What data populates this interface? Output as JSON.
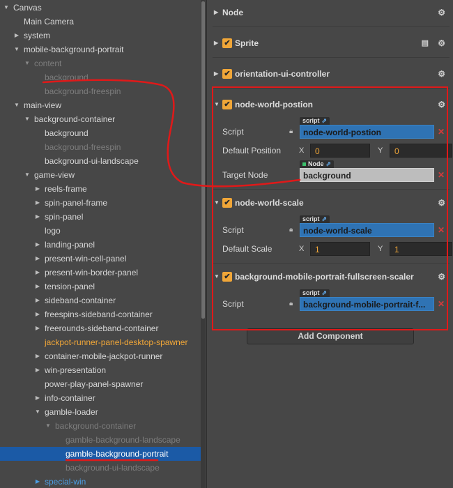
{
  "hierarchy": {
    "items": [
      {
        "label": "Canvas",
        "arrow": "down",
        "depth": 0,
        "style": ""
      },
      {
        "label": "Main Camera",
        "arrow": "",
        "depth": 1,
        "style": ""
      },
      {
        "label": "system",
        "arrow": "right",
        "depth": 1,
        "style": ""
      },
      {
        "label": "mobile-background-portrait",
        "arrow": "down",
        "depth": 1,
        "style": ""
      },
      {
        "label": "content",
        "arrow": "down",
        "depth": 2,
        "style": "dim"
      },
      {
        "label": "background",
        "arrow": "",
        "depth": 3,
        "style": "dim"
      },
      {
        "label": "background-freespin",
        "arrow": "",
        "depth": 3,
        "style": "dim"
      },
      {
        "label": "main-view",
        "arrow": "down",
        "depth": 1,
        "style": ""
      },
      {
        "label": "background-container",
        "arrow": "down",
        "depth": 2,
        "style": ""
      },
      {
        "label": "background",
        "arrow": "",
        "depth": 3,
        "style": ""
      },
      {
        "label": "background-freespin",
        "arrow": "",
        "depth": 3,
        "style": "dim"
      },
      {
        "label": "background-ui-landscape",
        "arrow": "",
        "depth": 3,
        "style": ""
      },
      {
        "label": "game-view",
        "arrow": "down",
        "depth": 2,
        "style": ""
      },
      {
        "label": "reels-frame",
        "arrow": "right",
        "depth": 3,
        "style": ""
      },
      {
        "label": "spin-panel-frame",
        "arrow": "right",
        "depth": 3,
        "style": ""
      },
      {
        "label": "spin-panel",
        "arrow": "right",
        "depth": 3,
        "style": ""
      },
      {
        "label": "logo",
        "arrow": "",
        "depth": 3,
        "style": ""
      },
      {
        "label": "landing-panel",
        "arrow": "right",
        "depth": 3,
        "style": ""
      },
      {
        "label": "present-win-cell-panel",
        "arrow": "right",
        "depth": 3,
        "style": ""
      },
      {
        "label": "present-win-border-panel",
        "arrow": "right",
        "depth": 3,
        "style": ""
      },
      {
        "label": "tension-panel",
        "arrow": "right",
        "depth": 3,
        "style": ""
      },
      {
        "label": "sideband-container",
        "arrow": "right",
        "depth": 3,
        "style": ""
      },
      {
        "label": "freespins-sideband-container",
        "arrow": "right",
        "depth": 3,
        "style": ""
      },
      {
        "label": "freerounds-sideband-container",
        "arrow": "right",
        "depth": 3,
        "style": ""
      },
      {
        "label": "jackpot-runner-panel-desktop-spawner",
        "arrow": "",
        "depth": 3,
        "style": "orange"
      },
      {
        "label": "container-mobile-jackpot-runner",
        "arrow": "right",
        "depth": 3,
        "style": ""
      },
      {
        "label": "win-presentation",
        "arrow": "right",
        "depth": 3,
        "style": ""
      },
      {
        "label": "power-play-panel-spawner",
        "arrow": "",
        "depth": 3,
        "style": ""
      },
      {
        "label": "info-container",
        "arrow": "right",
        "depth": 3,
        "style": ""
      },
      {
        "label": "gamble-loader",
        "arrow": "down",
        "depth": 3,
        "style": ""
      },
      {
        "label": "background-container",
        "arrow": "down",
        "depth": 4,
        "style": "dim"
      },
      {
        "label": "gamble-background-landscape",
        "arrow": "",
        "depth": 5,
        "style": "dim"
      },
      {
        "label": "gamble-background-portrait",
        "arrow": "",
        "depth": 5,
        "style": "sel"
      },
      {
        "label": "background-ui-landscape",
        "arrow": "",
        "depth": 5,
        "style": "dim"
      },
      {
        "label": "special-win",
        "arrow": "right",
        "depth": 3,
        "style": "blue"
      }
    ]
  },
  "inspector": {
    "node_title": "Node",
    "sprite_title": "Sprite",
    "orientation_title": "orientation-ui-controller",
    "nwp": {
      "title": "node-world-postion",
      "script_label": "Script",
      "script_tag": "script",
      "script_value": "node-world-postion",
      "default_position_label": "Default Position",
      "x_label": "X",
      "x_value": "0",
      "y_label": "Y",
      "y_value": "0",
      "target_label": "Target Node",
      "target_tag": "Node",
      "target_value": "background"
    },
    "nws": {
      "title": "node-world-scale",
      "script_label": "Script",
      "script_tag": "script",
      "script_value": "node-world-scale",
      "default_scale_label": "Default Scale",
      "x_label": "X",
      "x_value": "1",
      "y_label": "Y",
      "y_value": "1"
    },
    "bmp": {
      "title": "background-mobile-portrait-fullscreen-scaler",
      "script_label": "Script",
      "script_tag": "script",
      "script_value": "background-mobile-portrait-f..."
    },
    "add_component_label": "Add Component"
  },
  "colors": {
    "panel_bg": "#474747",
    "accent_orange": "#f0a638",
    "selection_blue": "#1b5aa6",
    "field_blue": "#2f73b4",
    "annotation_red": "#e01919"
  },
  "icons": [
    "expand-arrow-icon",
    "collapse-arrow-icon",
    "checkbox-icon",
    "gear-icon",
    "book-icon",
    "lock-icon",
    "external-link-icon",
    "clear-x-icon"
  ]
}
